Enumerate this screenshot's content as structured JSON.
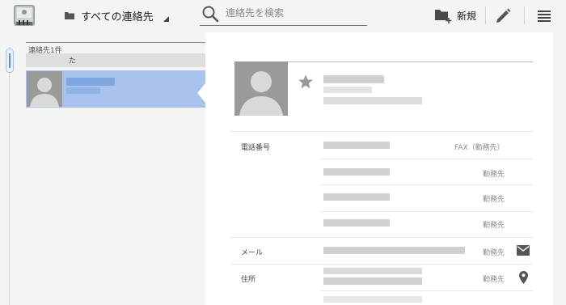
{
  "header": {
    "group_selector": "すべての連絡先",
    "search_placeholder": "連絡先を検索",
    "new_button_label": "新規"
  },
  "contact_list": {
    "count_label": "連絡先1件",
    "section_header": "た",
    "selected_index": 0
  },
  "detail": {
    "starred": false,
    "sections": [
      {
        "title": "電話番号",
        "rows": [
          {
            "type": "FAX（勤務先）",
            "icon": ""
          },
          {
            "type": "勤務先",
            "icon": ""
          },
          {
            "type": "勤務先",
            "icon": ""
          },
          {
            "type": "勤務先",
            "icon": ""
          }
        ]
      },
      {
        "title": "メール",
        "rows": [
          {
            "type": "勤務先",
            "icon": "email-icon"
          }
        ]
      },
      {
        "title": "住所",
        "rows": [
          {
            "type": "勤務先",
            "icon": "map-pin-icon"
          }
        ]
      }
    ]
  },
  "colors": {
    "accent": "#4f93e0",
    "selection": "#a8c4ee",
    "avatar_bg": "#9a9a9a"
  }
}
